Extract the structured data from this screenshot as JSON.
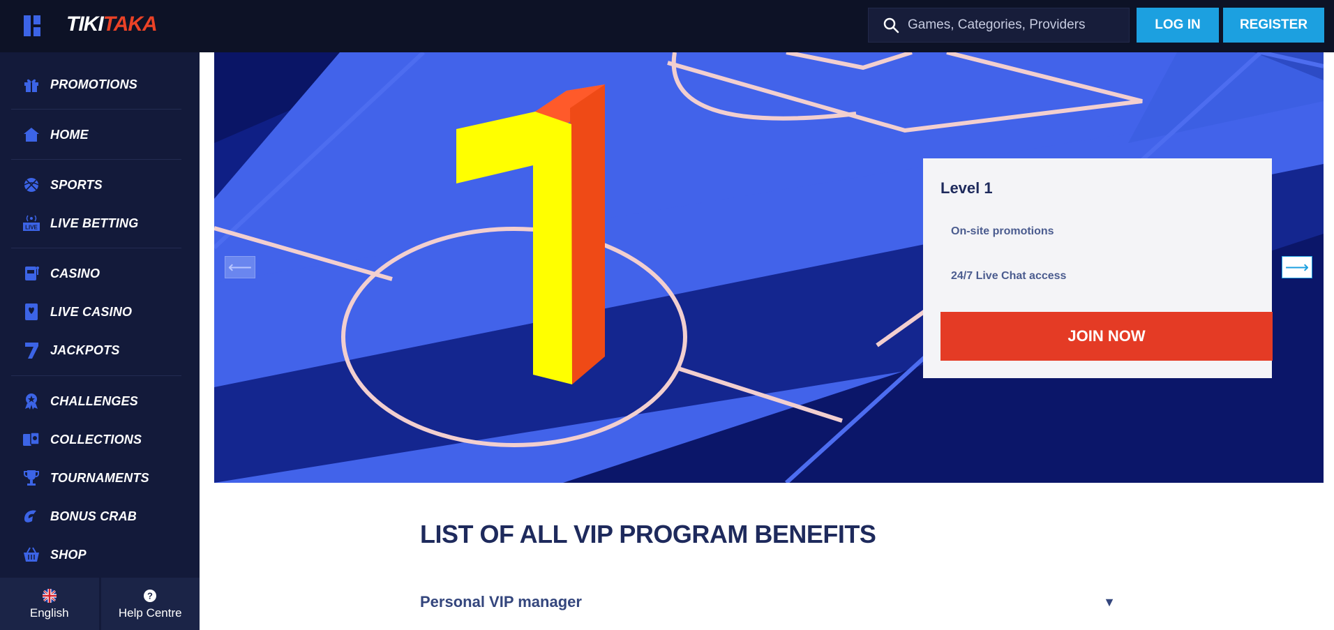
{
  "header": {
    "logo_part1": "TIKI",
    "logo_part2": "TAKA",
    "search_placeholder": "Games, Categories, Providers",
    "login_label": "LOG IN",
    "register_label": "REGISTER"
  },
  "sidebar": {
    "items": [
      {
        "label": "PROMOTIONS",
        "icon": "gift-icon"
      },
      {
        "label": "HOME",
        "icon": "home-icon"
      },
      {
        "label": "SPORTS",
        "icon": "ball-icon"
      },
      {
        "label": "LIVE BETTING",
        "icon": "live-icon"
      },
      {
        "label": "CASINO",
        "icon": "slot-machine-icon"
      },
      {
        "label": "LIVE CASINO",
        "icon": "card-icon"
      },
      {
        "label": "JACKPOTS",
        "icon": "seven-icon"
      },
      {
        "label": "CHALLENGES",
        "icon": "badge-icon"
      },
      {
        "label": "COLLECTIONS",
        "icon": "cards-icon"
      },
      {
        "label": "TOURNAMENTS",
        "icon": "trophy-icon"
      },
      {
        "label": "BONUS CRAB",
        "icon": "crab-icon"
      },
      {
        "label": "SHOP",
        "icon": "basket-icon"
      }
    ],
    "bottom": {
      "language": "English",
      "help": "Help Centre"
    }
  },
  "hero": {
    "big_number": "1",
    "level_title": "Level 1",
    "benefits": [
      "On-site promotions",
      "24/7 Live Chat access"
    ],
    "join_label": "JOIN NOW",
    "prev_arrow": "⟵",
    "next_arrow": "⟶"
  },
  "benefits_section": {
    "title": "LIST OF ALL VIP PROGRAM BENEFITS",
    "items": [
      {
        "label": "Personal VIP manager",
        "chevron": "▼"
      }
    ]
  },
  "colors": {
    "header_bg": "#0d1226",
    "sidebar_bg": "#131a3a",
    "accent_blue": "#1ca0e0",
    "join_red": "#e43b25",
    "field_blue": "#4263ea"
  }
}
